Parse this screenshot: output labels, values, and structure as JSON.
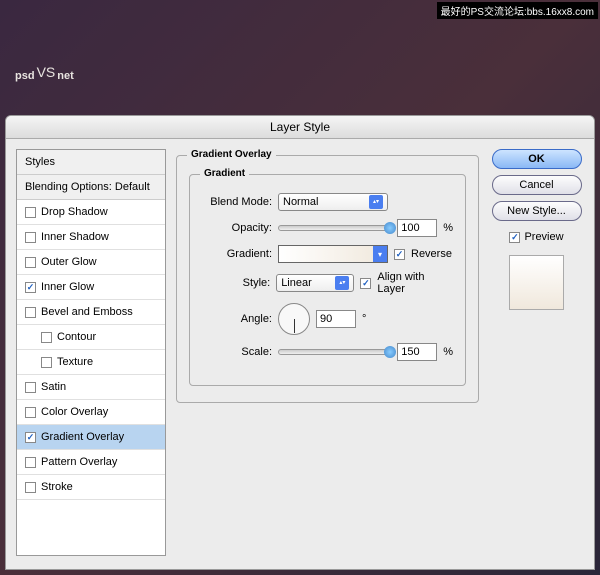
{
  "banner": "最好的PS交流论坛:bbs.16xx8.com",
  "logo": {
    "left": "psd",
    "mid": "VS",
    "right": "net"
  },
  "dialog": {
    "title": "Layer Style"
  },
  "sidebar": {
    "styles_header": "Styles",
    "blending_header": "Blending Options: Default",
    "items": [
      {
        "label": "Drop Shadow",
        "checked": false
      },
      {
        "label": "Inner Shadow",
        "checked": false
      },
      {
        "label": "Outer Glow",
        "checked": false
      },
      {
        "label": "Inner Glow",
        "checked": true
      },
      {
        "label": "Bevel and Emboss",
        "checked": false
      },
      {
        "label": "Contour",
        "checked": false,
        "indent": true
      },
      {
        "label": "Texture",
        "checked": false,
        "indent": true
      },
      {
        "label": "Satin",
        "checked": false
      },
      {
        "label": "Color Overlay",
        "checked": false
      },
      {
        "label": "Gradient Overlay",
        "checked": true,
        "selected": true
      },
      {
        "label": "Pattern Overlay",
        "checked": false
      },
      {
        "label": "Stroke",
        "checked": false
      }
    ]
  },
  "panel": {
    "title": "Gradient Overlay",
    "group": "Gradient",
    "blend_mode_label": "Blend Mode:",
    "blend_mode_value": "Normal",
    "opacity_label": "Opacity:",
    "opacity_value": "100",
    "opacity_unit": "%",
    "gradient_label": "Gradient:",
    "reverse_label": "Reverse",
    "reverse_checked": true,
    "style_label": "Style:",
    "style_value": "Linear",
    "align_label": "Align with Layer",
    "align_checked": true,
    "angle_label": "Angle:",
    "angle_value": "90",
    "angle_unit": "°",
    "scale_label": "Scale:",
    "scale_value": "150",
    "scale_unit": "%"
  },
  "buttons": {
    "ok": "OK",
    "cancel": "Cancel",
    "new_style": "New Style...",
    "preview": "Preview",
    "preview_checked": true
  }
}
